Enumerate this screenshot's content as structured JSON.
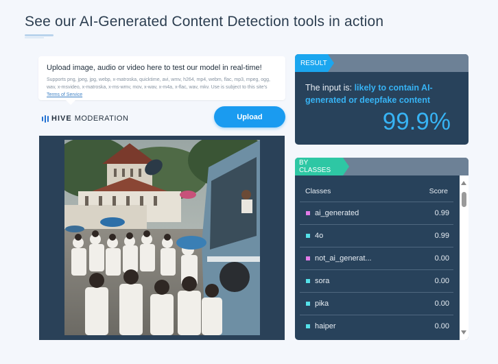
{
  "page": {
    "title": "See our AI-Generated Content Detection tools in action"
  },
  "upload": {
    "headline": "Upload image, audio or video here to test our model in real-time!",
    "formats_text": "Supports png, jpeg, jpg, webp, x-matroska, quicktime, avi, wmv, h264, mp4, webm, flac, mp3, mpeg, ogg, wav, x-msvideo, x-matroska, x-ms-wmv, mov, x-wav, x-m4a, x-flac, wav, mkv. Use is subject to this site's",
    "tos_link": "Terms of Service",
    "button_label": "Upload"
  },
  "brand": {
    "name_bold": "HIVE",
    "name_rest": "MODERATION"
  },
  "preview": {
    "image_icon": "photo-icon"
  },
  "result": {
    "tag": "RESULT",
    "prefix": "The input is:",
    "verdict": "likely to contain AI-generated or deepfake content",
    "score": "99.9%"
  },
  "classes": {
    "tag": "BY CLASSES",
    "col_classes": "Classes",
    "col_score": "Score",
    "rows": [
      {
        "name": "ai_generated",
        "score": "0.99",
        "color": "#e27be8"
      },
      {
        "name": "4o",
        "score": "0.99",
        "color": "#55e2ea"
      },
      {
        "name": "not_ai_generat...",
        "score": "0.00",
        "color": "#e27be8"
      },
      {
        "name": "sora",
        "score": "0.00",
        "color": "#55e2ea"
      },
      {
        "name": "pika",
        "score": "0.00",
        "color": "#55e2ea"
      },
      {
        "name": "haiper",
        "score": "0.00",
        "color": "#55e2ea"
      }
    ]
  },
  "colors": {
    "accent": "#1a9bf0",
    "panel": "#28425b",
    "result_tag": "#1ba6ef",
    "classes_tag": "#2ec7a4"
  }
}
